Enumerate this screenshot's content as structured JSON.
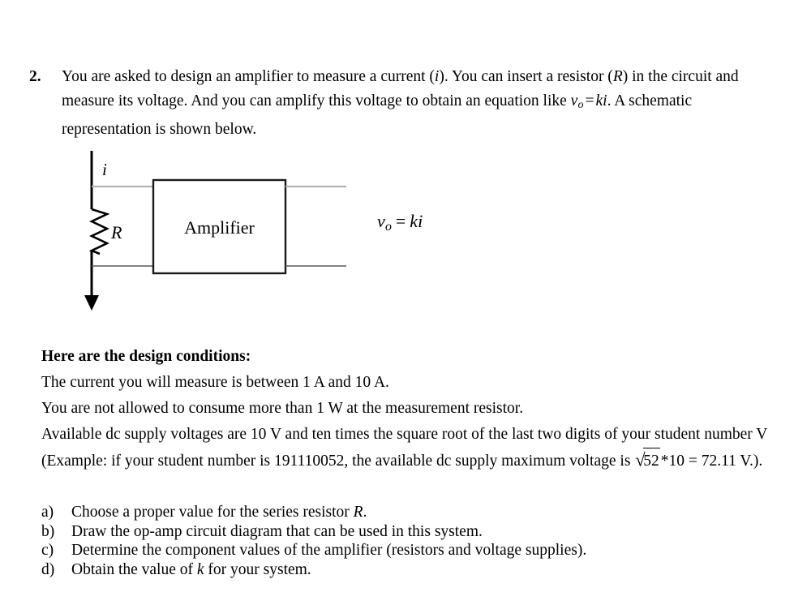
{
  "question": {
    "number": "2.",
    "paragraph": {
      "part1": "You are asked to design an amplifier to measure a current (",
      "var_i": "i",
      "part2": "). You can insert a resistor (",
      "var_R": "R",
      "part3": ") in the circuit and measure its voltage. And you can amplify this voltage to obtain an equation like ",
      "eq_v": "v",
      "eq_v_sub": "o",
      "eq_equals": "=",
      "eq_k": "k",
      "eq_i": "i",
      "part4": ". A schematic representation is shown below."
    }
  },
  "diagram": {
    "current_label": "i",
    "resistor_label": "R",
    "amplifier_label": "Amplifier",
    "output_equation": {
      "v": "v",
      "sub": "o",
      "equals": "=",
      "k": "k",
      "i": "i"
    },
    "colors": {
      "wire_top": "#b3b3b3",
      "wire_bottom": "#595959",
      "main_line": "#000000",
      "box_border": "#1a1a1a"
    }
  },
  "conditions": {
    "heading": "Here are the design conditions:",
    "line1": "The current you will measure is between 1 A and 10 A.",
    "line2": "You are not allowed to consume more than 1 W at the measurement resistor.",
    "line3a": "Available dc supply voltages are 10 V and ten times the square root of the last two digits of your student number V (Example: if your student number is 191110052, the available dc supply maximum voltage is ",
    "radical_sign": "√",
    "radicand": "52",
    "line3b": "*10 = 72.11 V.).",
    "student_number": "191110052"
  },
  "subquestions": [
    {
      "marker": "a)",
      "text_before": "Choose a proper value for the series resistor ",
      "symbol": "R",
      "text_after": "."
    },
    {
      "marker": "b)",
      "text_before": "Draw the op-amp circuit diagram that can be used in this system.",
      "symbol": "",
      "text_after": ""
    },
    {
      "marker": "c)",
      "text_before": "Determine the component values of the amplifier (resistors and voltage supplies).",
      "symbol": "",
      "text_after": ""
    },
    {
      "marker": "d)",
      "text_before": "Obtain the value of ",
      "symbol": "k",
      "text_after": " for your system."
    }
  ]
}
